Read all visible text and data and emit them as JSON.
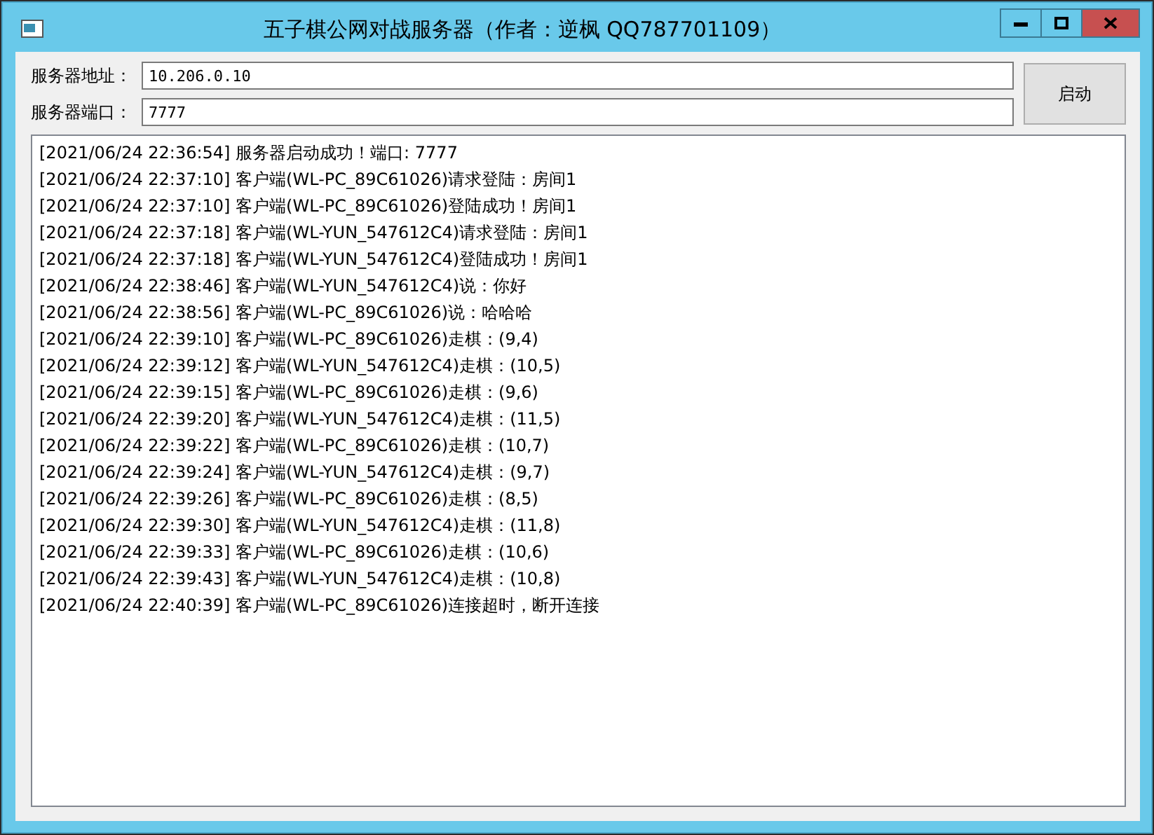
{
  "window": {
    "title": "五子棋公网对战服务器（作者：逆枫 QQ787701109）"
  },
  "fields": [
    {
      "label": "服务器地址：",
      "value": "10.206.0.10"
    },
    {
      "label": "服务器端口：",
      "value": "7777"
    }
  ],
  "start_button": {
    "label": "启动"
  },
  "log": [
    "[2021/06/24 22:36:54] 服务器启动成功！端口: 7777",
    "[2021/06/24 22:37:10] 客户端(WL-PC_89C61026)请求登陆：房间1",
    "[2021/06/24 22:37:10] 客户端(WL-PC_89C61026)登陆成功！房间1",
    "[2021/06/24 22:37:18] 客户端(WL-YUN_547612C4)请求登陆：房间1",
    "[2021/06/24 22:37:18] 客户端(WL-YUN_547612C4)登陆成功！房间1",
    "[2021/06/24 22:38:46] 客户端(WL-YUN_547612C4)说：你好",
    "[2021/06/24 22:38:56] 客户端(WL-PC_89C61026)说：哈哈哈",
    "[2021/06/24 22:39:10] 客户端(WL-PC_89C61026)走棋：(9,4)",
    "[2021/06/24 22:39:12] 客户端(WL-YUN_547612C4)走棋：(10,5)",
    "[2021/06/24 22:39:15] 客户端(WL-PC_89C61026)走棋：(9,6)",
    "[2021/06/24 22:39:20] 客户端(WL-YUN_547612C4)走棋：(11,5)",
    "[2021/06/24 22:39:22] 客户端(WL-PC_89C61026)走棋：(10,7)",
    "[2021/06/24 22:39:24] 客户端(WL-YUN_547612C4)走棋：(9,7)",
    "[2021/06/24 22:39:26] 客户端(WL-PC_89C61026)走棋：(8,5)",
    "[2021/06/24 22:39:30] 客户端(WL-YUN_547612C4)走棋：(11,8)",
    "[2021/06/24 22:39:33] 客户端(WL-PC_89C61026)走棋：(10,6)",
    "[2021/06/24 22:39:43] 客户端(WL-YUN_547612C4)走棋：(10,8)",
    "[2021/06/24 22:40:39] 客户端(WL-PC_89C61026)连接超时，断开连接"
  ]
}
